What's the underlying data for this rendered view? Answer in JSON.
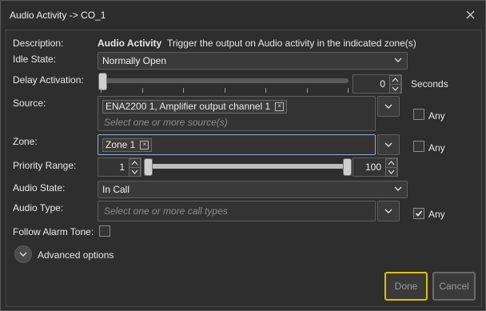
{
  "window": {
    "title": "Audio Activity -> CO_1"
  },
  "description": {
    "label": "Description:",
    "name": "Audio Activity",
    "text": "Trigger the output on Audio activity in the indicated zone(s)"
  },
  "idle_state": {
    "label": "Idle State:",
    "value": "Normally Open"
  },
  "delay": {
    "label": "Delay Activation:",
    "value": "0",
    "unit": "Seconds",
    "slider_value": 0
  },
  "source": {
    "label": "Source:",
    "chips": [
      "ENA2200 1, Amplifier output channel 1"
    ],
    "placeholder": "Select one or more source(s)",
    "any_label": "Any",
    "any_checked": false
  },
  "zone": {
    "label": "Zone:",
    "chips": [
      "Zone 1"
    ],
    "any_label": "Any",
    "any_checked": false
  },
  "priority": {
    "label": "Priority Range:",
    "min": "1",
    "max": "100"
  },
  "audio_state": {
    "label": "Audio State:",
    "value": "In Call"
  },
  "audio_type": {
    "label": "Audio Type:",
    "placeholder": "Select one or more call types",
    "any_label": "Any",
    "any_checked": true
  },
  "follow_alarm": {
    "label": "Follow Alarm Tone:",
    "checked": false
  },
  "advanced": {
    "label": "Advanced options"
  },
  "buttons": {
    "done": "Done",
    "cancel": "Cancel"
  },
  "colors": {
    "accent_focus": "#e1c000",
    "background": "#2d2d2d"
  }
}
